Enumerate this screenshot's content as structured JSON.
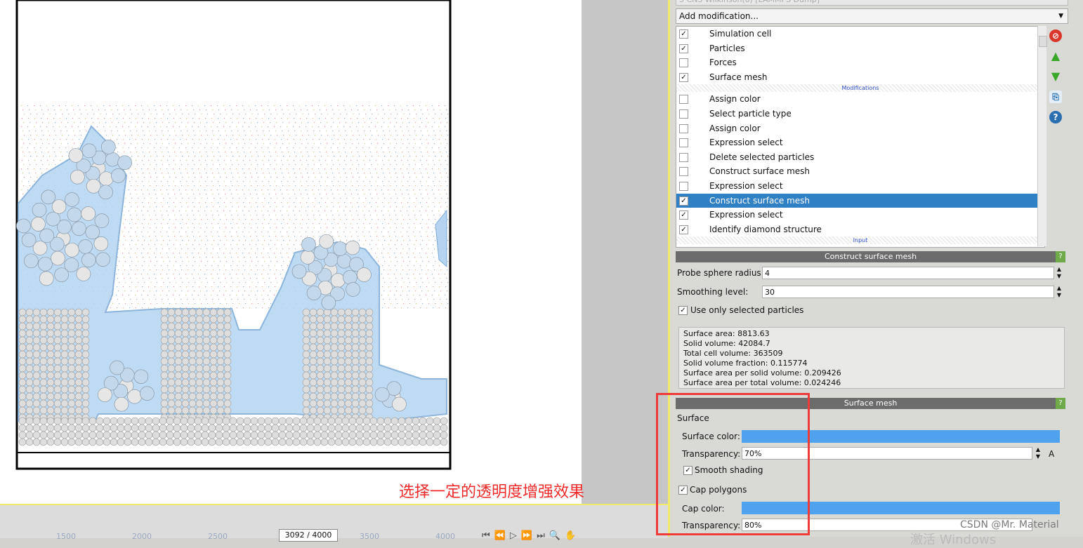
{
  "source_field": "3 CNS Wilkinson(o) [LAMMPS Dump]",
  "add_modification": "Add modification...",
  "pipeline": {
    "data_items": [
      {
        "label": "Simulation cell",
        "checked": true
      },
      {
        "label": "Particles",
        "checked": true
      },
      {
        "label": "Forces",
        "checked": false
      },
      {
        "label": "Surface mesh",
        "checked": true
      }
    ],
    "modifications_header": "Modifications",
    "modifications": [
      {
        "label": "Assign color",
        "checked": false
      },
      {
        "label": "Select particle type",
        "checked": false
      },
      {
        "label": "Assign color",
        "checked": false
      },
      {
        "label": "Expression select",
        "checked": false
      },
      {
        "label": "Delete selected particles",
        "checked": false
      },
      {
        "label": "Construct surface mesh",
        "checked": false
      },
      {
        "label": "Expression select",
        "checked": false
      },
      {
        "label": "Construct surface mesh",
        "checked": true,
        "selected": true
      },
      {
        "label": "Expression select",
        "checked": true
      },
      {
        "label": "Identify diamond structure",
        "checked": true
      }
    ],
    "input_header": "Input"
  },
  "csm_panel": {
    "title": "Construct surface mesh",
    "help": "?",
    "probe_label": "Probe sphere radius:",
    "probe_value": "4",
    "smooth_label": "Smoothing level:",
    "smooth_value": "30",
    "only_selected_label": "Use only selected particles",
    "info": [
      "Surface area: 8813.63",
      "Solid volume: 42084.7",
      "Total cell volume: 363509",
      "Solid volume fraction: 0.115774",
      "Surface area per solid volume: 0.209426",
      "Surface area per total volume: 0.024246"
    ]
  },
  "sm_panel": {
    "title": "Surface mesh",
    "help": "?",
    "surface_group": "Surface",
    "surface_color_label": "Surface color:",
    "transparency_label": "Transparency:",
    "surface_transparency": "70%",
    "anim_a": "A",
    "smooth_shading_label": "Smooth shading",
    "cap_polygons_label": "Cap polygons",
    "cap_color_label": "Cap color:",
    "cap_transparency_label": "Transparency:",
    "cap_transparency": "80%",
    "surface_color": "#4ea2ee"
  },
  "timeline": {
    "ticks": [
      "1500",
      "2000",
      "2500",
      "3500",
      "4000"
    ],
    "frame": "3092 / 4000"
  },
  "annotation": "选择一定的透明度增强效果",
  "watermark": "CSDN @Mr. Material",
  "watermark_bg": "激活 Windows"
}
